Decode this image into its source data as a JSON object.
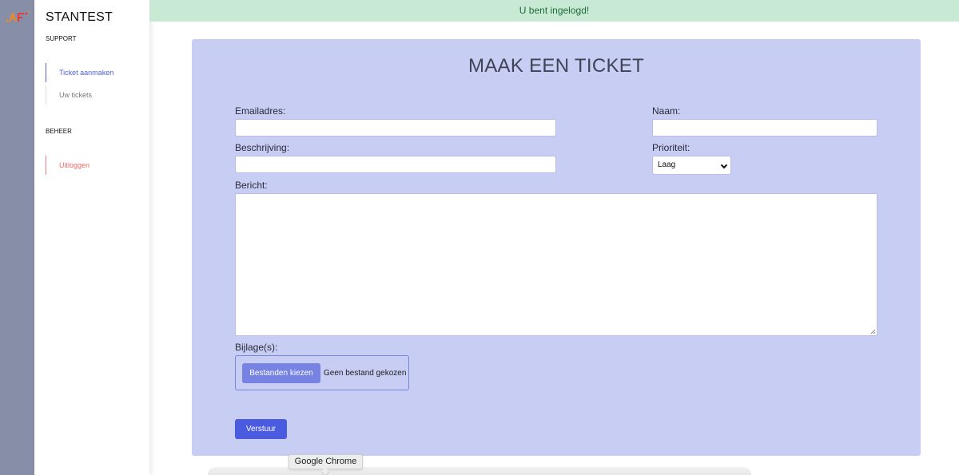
{
  "app": {
    "brand": "STANTEST"
  },
  "sidebar": {
    "sections": [
      {
        "label": "SUPPORT"
      },
      {
        "label": "BEHEER"
      }
    ],
    "items": [
      {
        "label": "Ticket aanmaken"
      },
      {
        "label": "Uw tickets"
      },
      {
        "label": "Uitloggen"
      }
    ]
  },
  "flash": {
    "message": "U bent ingelogd!"
  },
  "form": {
    "title": "MAAK EEN TICKET",
    "email_label": "Emailadres:",
    "email_value": "",
    "name_label": "Naam:",
    "name_value": "",
    "description_label": "Beschrijving:",
    "description_value": "",
    "priority_label": "Prioriteit:",
    "priority_value": "Laag",
    "message_label": "Bericht:",
    "message_value": "",
    "attachment_label": "Bijlage(s):",
    "file_button": "Bestanden kiezen",
    "file_status": "Geen bestand gekozen",
    "submit_label": "Verstuur"
  },
  "tooltip": {
    "text": "Google Chrome"
  },
  "colors": {
    "accent": "#4a5be0",
    "card_bg": "#c8cdf3",
    "flash_bg": "#c8ead4",
    "danger": "#f06a6a"
  },
  "icons": {
    "logo": "af-logo-icon",
    "select_arrow": "chevron-down-icon"
  }
}
